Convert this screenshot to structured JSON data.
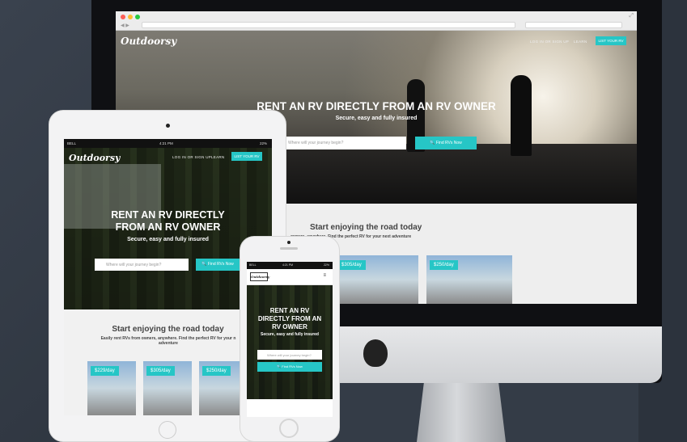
{
  "brand": "Outdoorsy",
  "nav": {
    "login": "LOG IN OR SIGN UP",
    "learn": "LEARN",
    "list": "LIST YOUR RV"
  },
  "hero": {
    "title": "RENT AN RV DIRECTLY FROM AN RV OWNER",
    "subtitle": "Secure, easy and fully insured",
    "placeholder": "Where will your journey begin?",
    "button": "Find RVs Now"
  },
  "section": {
    "title": "Start enjoying the road today",
    "subtitle": "Easily rent RVs from owners, anywhere. Find the perfect RV for your next adventure",
    "subtitle_desktop": "owners, anywhere. Find the perfect RV for your next adventure"
  },
  "ipad_hero_title_lines": [
    "RENT AN RV DIRECTLY",
    "FROM AN RV OWNER"
  ],
  "iphone_hero_title_lines": [
    "RENT AN RV",
    "DIRECTLY FROM AN",
    "RV OWNER"
  ],
  "status": {
    "carrier": "BELL",
    "time": "4:21 PM",
    "battery": "22%"
  },
  "prices": [
    "$305/day",
    "$250/day",
    "$229/day",
    "$305/day",
    "$250/day"
  ],
  "ipad_section_subtitle_lines": [
    "Easily rent RVs from owners, anywhere. Find the perfect RV for your n",
    "adventure"
  ],
  "accent": "#26c6c6"
}
